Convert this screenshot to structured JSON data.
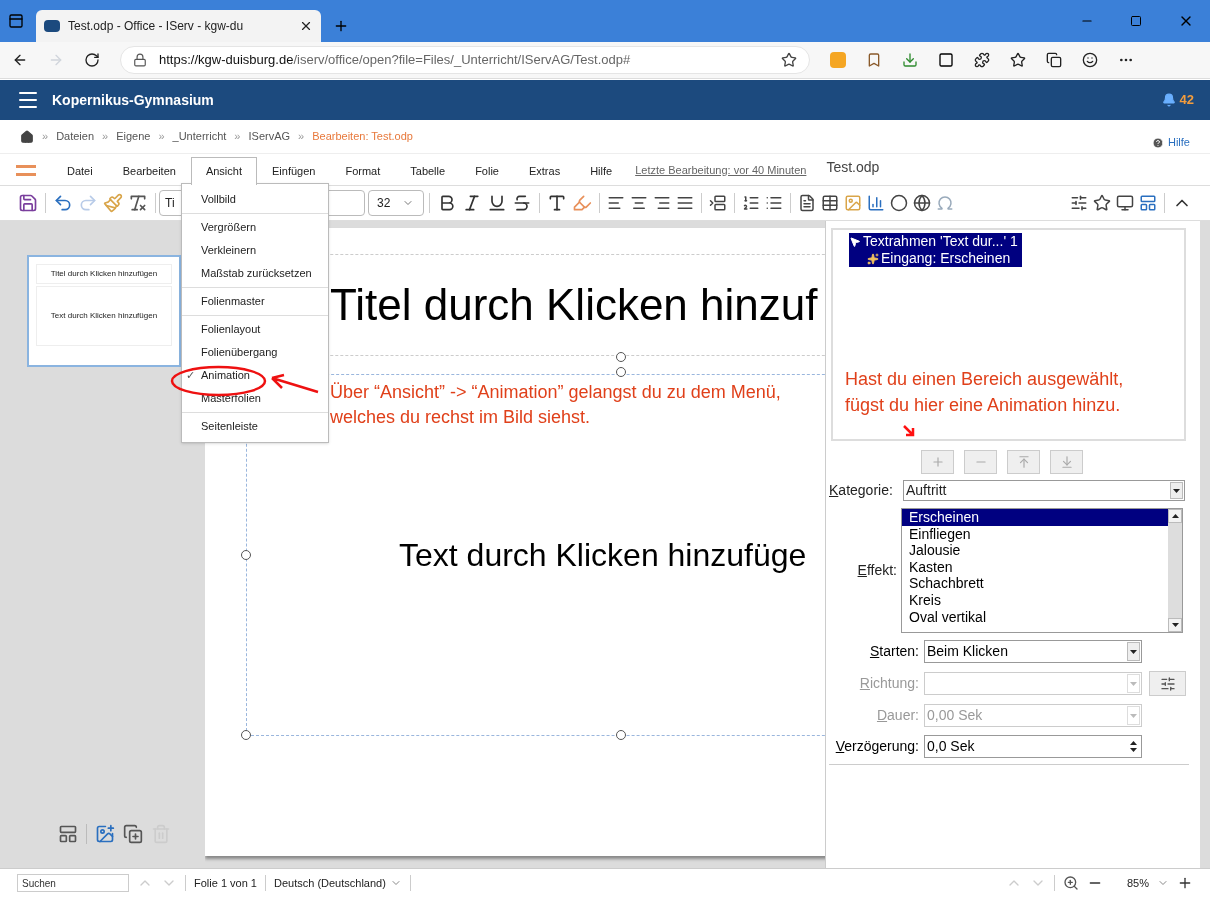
{
  "browser": {
    "tab_title": "Test.odp - Office - IServ - kgw-du",
    "url_host": "https://kgw-duisburg.de",
    "url_path": "/iserv/office/open?file=Files/_Unterricht/IServAG/Test.odp#"
  },
  "app_header": {
    "title": "Kopernikus-Gymnasium",
    "notifications": "42"
  },
  "breadcrumb": {
    "items": [
      {
        "label": "Dateien",
        "current": false
      },
      {
        "label": "Eigene",
        "current": false
      },
      {
        "label": "_Unterricht",
        "current": false
      },
      {
        "label": "IServAG",
        "current": false
      },
      {
        "label": "Bearbeiten: Test.odp",
        "current": true
      }
    ],
    "separator": "»",
    "help": "Hilfe"
  },
  "menu_bar": {
    "items": [
      {
        "label": "Datei",
        "selected": false
      },
      {
        "label": "Bearbeiten",
        "selected": false
      },
      {
        "label": "Ansicht",
        "selected": true
      },
      {
        "label": "Einfügen",
        "selected": false
      },
      {
        "label": "Format",
        "selected": false
      },
      {
        "label": "Tabelle",
        "selected": false
      },
      {
        "label": "Folie",
        "selected": false
      },
      {
        "label": "Extras",
        "selected": false
      },
      {
        "label": "Hilfe",
        "selected": false
      }
    ],
    "last_edit": "Letzte Bearbeitung: vor 40 Minuten",
    "document_title": "Test.odp"
  },
  "view_menu": {
    "groups": [
      [
        {
          "label": "Vollbild",
          "checked": false
        }
      ],
      [
        {
          "label": "Vergrößern",
          "checked": false
        },
        {
          "label": "Verkleinern",
          "checked": false
        },
        {
          "label": "Maßstab zurücksetzen",
          "checked": false
        }
      ],
      [
        {
          "label": "Folienmaster",
          "checked": false
        }
      ],
      [
        {
          "label": "Folienlayout",
          "checked": false
        },
        {
          "label": "Folienübergang",
          "checked": false
        },
        {
          "label": "Animation",
          "checked": true
        },
        {
          "label": "Masterfolien",
          "checked": false
        }
      ],
      [
        {
          "label": "Seitenleiste",
          "checked": false
        }
      ]
    ],
    "check_mark": "✓"
  },
  "toolbar": {
    "font_name": "Ti",
    "font_size": "32"
  },
  "slide_panel": {
    "thumbnails": [
      {
        "title": "Titel durch Klicken hinzufügen",
        "body": "Text durch Klicken hinzufügen",
        "selected": true
      }
    ]
  },
  "slide": {
    "title": "Titel durch Klicken hinzuf",
    "body": "Text durch Klicken hinzufüge"
  },
  "annotations": [
    {
      "text": "Über “Ansicht” -> “Animation” gelangst du zu dem Menü, welches du rechst im Bild siehst."
    },
    {
      "text": "Hast du einen Bereich ausgewählt, fügst du hier eine Animation hinzu."
    }
  ],
  "animation_panel": {
    "entries": [
      {
        "label": "Textrahmen 'Text dur...' 1",
        "kind": "shape",
        "selected": true
      },
      {
        "label": "Eingang: Erscheinen",
        "kind": "effect",
        "selected": true
      }
    ],
    "category": {
      "label": "Kategorie:",
      "value": "Auftritt"
    },
    "effect": {
      "label": "Effekt:",
      "items": [
        {
          "label": "Erscheinen",
          "selected": true
        },
        {
          "label": "Einfliegen",
          "selected": false
        },
        {
          "label": "Jalousie",
          "selected": false
        },
        {
          "label": "Kasten",
          "selected": false
        },
        {
          "label": "Schachbrett",
          "selected": false
        },
        {
          "label": "Kreis",
          "selected": false
        },
        {
          "label": "Oval vertikal",
          "selected": false
        }
      ]
    },
    "fields": [
      {
        "label": "Starten:",
        "value": "Beim Klicken",
        "kind": "dropdown",
        "disabled": false
      },
      {
        "label": "Richtung:",
        "kind": "dropdown",
        "disabled": true
      },
      {
        "label": "Dauer:",
        "value": "0,00 Sek",
        "kind": "dropdown",
        "disabled": true
      },
      {
        "label": "Verzögerung:",
        "value": "0,0 Sek",
        "kind": "spin",
        "disabled": false
      }
    ]
  },
  "status_bar": {
    "search_placeholder": "Suchen",
    "slide_count": "Folie 1 von 1",
    "language": "Deutsch (Deutschland)",
    "zoom": "85%"
  }
}
